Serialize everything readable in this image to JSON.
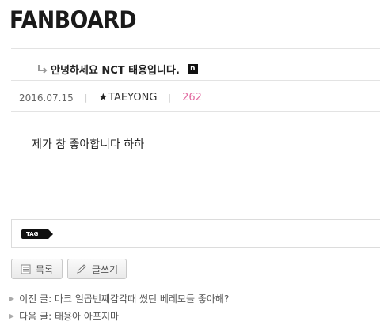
{
  "brand": {
    "logo": "FANBOARD"
  },
  "post": {
    "title": "안녕하세요 NCT 태용입니다.",
    "new_badge": "n",
    "date": "2016.07.15",
    "author": "TAEYONG",
    "views": "262",
    "content": "제가 참 좋아합니다 하하"
  },
  "tag": {
    "label": "TAG"
  },
  "buttons": {
    "list": "목록",
    "write": "글쓰기"
  },
  "nav": {
    "prev_label": "이전 글:",
    "prev_title": "마크 일곱번째감각때 썼던 베레모들 좋아해?",
    "next_label": "다음 글:",
    "next_title": "태용아 아프지마"
  },
  "colors": {
    "views": "#e26aa0",
    "badge": "#111111"
  }
}
